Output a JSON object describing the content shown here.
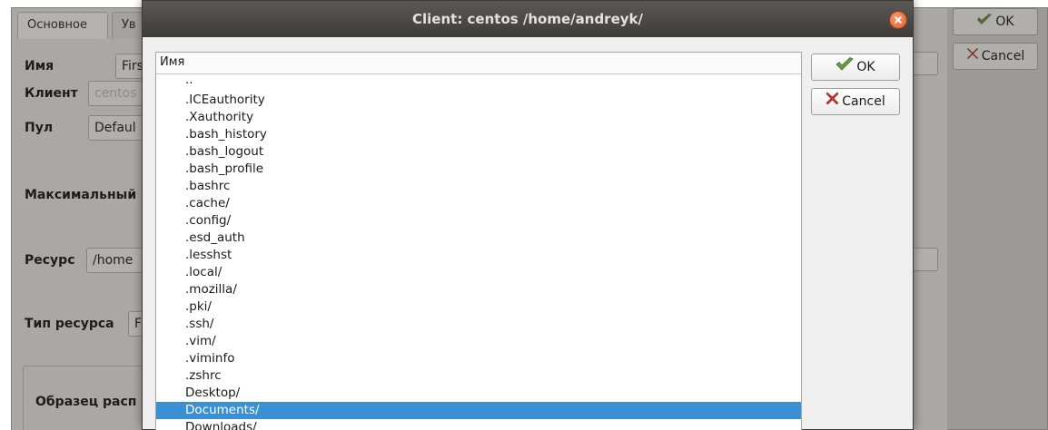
{
  "background": {
    "tabs": [
      "Основное",
      "Ув"
    ],
    "labels": {
      "name": "Имя",
      "client": "Клиент",
      "pool": "Пул",
      "max": "Максимальный",
      "resource": "Ресурс",
      "resource_type": "Тип ресурса",
      "sample": "Образец расп"
    },
    "fields": {
      "name": "Firs",
      "client": "centos",
      "pool": "Defaul",
      "resource": "/home",
      "resource_type": "F"
    },
    "buttons": {
      "ok": "OK",
      "cancel": "Cancel"
    }
  },
  "dialog": {
    "title": "Client: centos /home/andreyk/",
    "list_header": "Имя",
    "items": [
      "..",
      ".ICEauthority",
      ".Xauthority",
      ".bash_history",
      ".bash_logout",
      ".bash_profile",
      ".bashrc",
      ".cache/",
      ".config/",
      ".esd_auth",
      ".lesshst",
      ".local/",
      ".mozilla/",
      ".pki/",
      ".ssh/",
      ".vim/",
      ".viminfo",
      ".zshrc",
      "Desktop/",
      "Documents/",
      "Downloads/"
    ],
    "selected_index": 19,
    "buttons": {
      "ok": "OK",
      "cancel": "Cancel"
    }
  },
  "colors": {
    "selection": "#3b8fd3",
    "close": "#e35e2c",
    "ok_icon": "#5f8f3a",
    "cancel_icon": "#c0392b"
  },
  "icons": {
    "ok": "check-arrow-icon",
    "cancel": "x-mark-icon"
  }
}
